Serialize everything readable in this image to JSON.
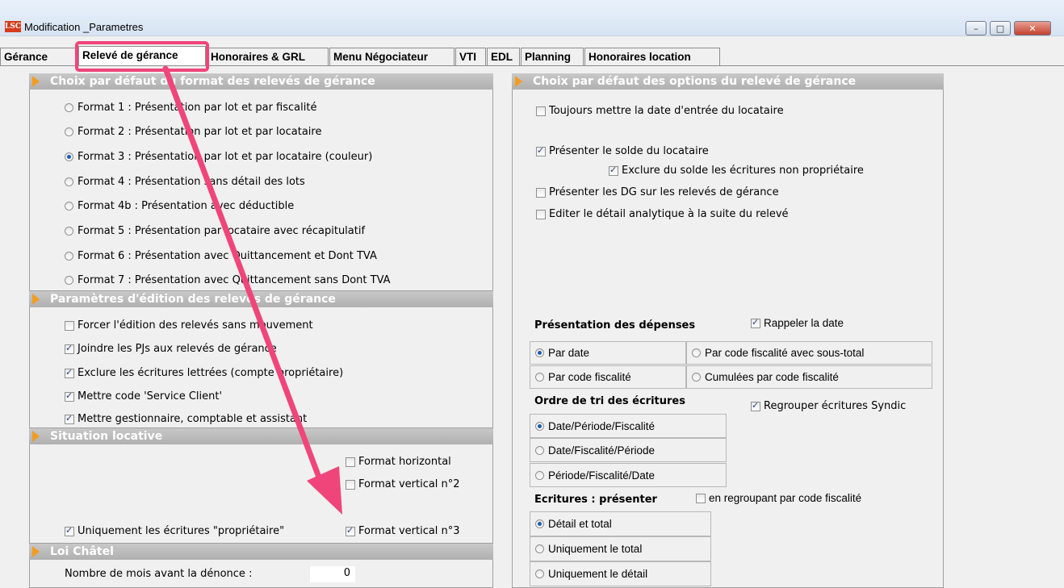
{
  "window": {
    "title": "Modification _Parametres",
    "logo": "LSC",
    "minimize": "–",
    "maximize": "□",
    "close": "✕"
  },
  "tabs": [
    {
      "label": "Gérance"
    },
    {
      "label": "Relevé de gérance"
    },
    {
      "label": "Honoraires & GRL"
    },
    {
      "label": "Menu Négociateur"
    },
    {
      "label": "VTI"
    },
    {
      "label": "EDL"
    },
    {
      "label": "Planning"
    },
    {
      "label": "Honoraires location"
    }
  ],
  "left": {
    "format": {
      "title": "Choix par défaut du format des relevés de gérance",
      "options": [
        {
          "label": "Format 1 : Présentation par lot et par fiscalité",
          "selected": false
        },
        {
          "label": "Format 2 : Présentation par lot et par locataire",
          "selected": false
        },
        {
          "label": "Format 3 : Présentation par lot et par locataire (couleur)",
          "selected": true
        },
        {
          "label": "Format 4 : Présentation sans détail des lots",
          "selected": false
        },
        {
          "label": "Format 4b : Présentation avec déductible",
          "selected": false
        },
        {
          "label": "Format 5 : Présentation par locataire avec récapitulatif",
          "selected": false
        },
        {
          "label": "Format 6 : Présentation avec Quittancement et Dont TVA",
          "selected": false
        },
        {
          "label": "Format 7 : Présentation avec Quittancement sans Dont TVA",
          "selected": false
        }
      ]
    },
    "edition": {
      "title": "Paramètres d'édition des relevés de gérance",
      "options": [
        {
          "label": "Forcer l'édition des relevés sans mouvement",
          "checked": false
        },
        {
          "label": "Joindre les PJs aux relevés de gérance",
          "checked": true
        },
        {
          "label": "Exclure les écritures lettrées (compte propriétaire)",
          "checked": true
        },
        {
          "label": "Mettre code 'Service Client'",
          "checked": true
        },
        {
          "label": "Mettre gestionnaire, comptable et assistant",
          "checked": true
        }
      ]
    },
    "situation": {
      "title": "Situation locative",
      "format_horizontal": "Format horizontal",
      "format_vertical_2": "Format vertical n°2",
      "format_vertical_3": "Format vertical n°3",
      "uniquement": "Uniquement les écritures \"propriétaire\""
    },
    "chatel": {
      "title": "Loi Châtel",
      "label": "Nombre de mois avant la dénonce :",
      "value": "0"
    }
  },
  "right": {
    "options": {
      "title": "Choix par défaut des options du relevé de gérance",
      "toujours": "Toujours mettre la date d'entrée du locataire",
      "presenter_solde": "Présenter le solde du locataire",
      "exclure_solde": "Exclure du solde les écritures non propriétaire",
      "presenter_dg": "Présenter les DG sur les relevés de gérance",
      "editer": "Editer le détail analytique à la suite du relevé"
    },
    "depenses": {
      "title": "Présentation des dépenses",
      "rappeler": "Rappeler la date",
      "par_date": "Par date",
      "par_code_sous_total": "Par code fiscalité avec sous-total",
      "par_code": "Par code fiscalité",
      "cumulees": "Cumulées par code fiscalité"
    },
    "tri": {
      "title": "Ordre de tri des écritures",
      "regrouper": "Regrouper écritures Syndic",
      "options": [
        {
          "label": "Date/Période/Fiscalité",
          "selected": true
        },
        {
          "label": "Date/Fiscalité/Période",
          "selected": false
        },
        {
          "label": "Période/Fiscalité/Date",
          "selected": false
        }
      ]
    },
    "ecritures": {
      "title": "Ecritures : présenter",
      "regroupant": "en regroupant par code fiscalité",
      "options": [
        {
          "label": "Détail et total",
          "selected": true
        },
        {
          "label": "Uniquement le total",
          "selected": false
        },
        {
          "label": "Uniquement le détail",
          "selected": false
        }
      ]
    }
  },
  "colors": {
    "highlight": "#f0457b",
    "section_header": "#b8b8b8",
    "chevron": "#f39c1f"
  }
}
